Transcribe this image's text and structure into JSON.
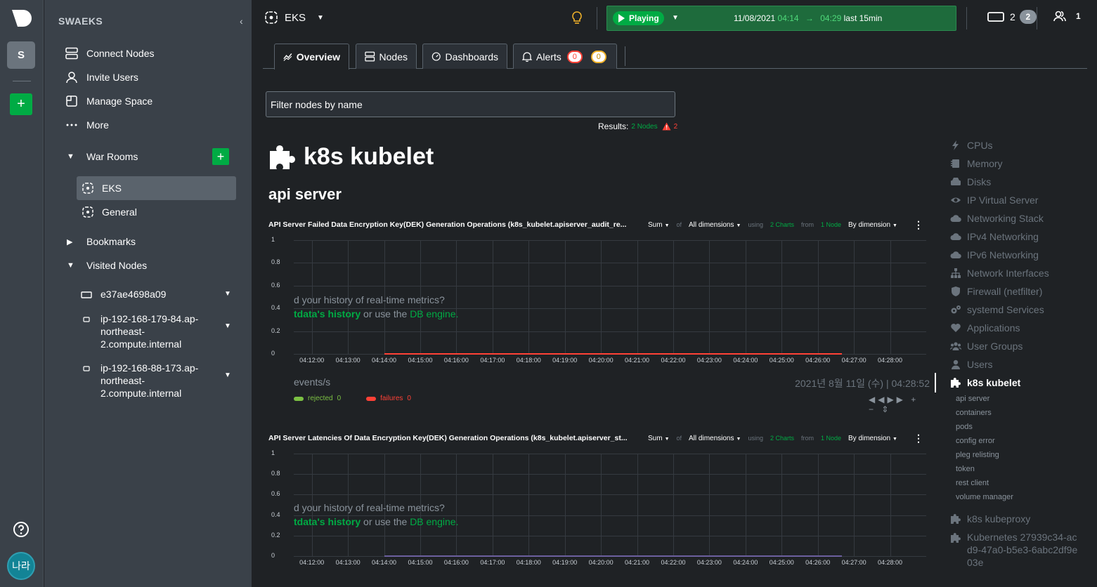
{
  "space": {
    "initial": "S",
    "name": "SWAEKS",
    "collapse": "‹"
  },
  "user": {
    "avatar_text": "나라"
  },
  "sidebar": {
    "items": [
      {
        "label": "Connect Nodes"
      },
      {
        "label": "Invite Users"
      },
      {
        "label": "Manage Space"
      },
      {
        "label": "More"
      }
    ],
    "war_rooms_label": "War Rooms",
    "rooms": [
      {
        "label": "EKS"
      },
      {
        "label": "General"
      }
    ],
    "bookmarks_label": "Bookmarks",
    "visited_label": "Visited Nodes",
    "visited_nodes": [
      {
        "label": "e37ae4698a09"
      },
      {
        "label": "ip-192-168-179-84.ap-northeast-2.compute.internal"
      },
      {
        "label": "ip-192-168-88-173.ap-northeast-2.compute.internal"
      }
    ]
  },
  "header": {
    "room": "EKS",
    "playing": "Playing",
    "date": "11/08/2021",
    "from": "04:14",
    "arrow": "→",
    "to": "04:29",
    "range": "last 15min",
    "nodes_count": "2",
    "nodes_badge": "2",
    "users_count": "1"
  },
  "tabs": [
    {
      "label": "Overview"
    },
    {
      "label": "Nodes"
    },
    {
      "label": "Dashboards"
    },
    {
      "label": "Alerts",
      "critical": "0",
      "warning": "0"
    }
  ],
  "filter": {
    "placeholder": "Filter nodes by name"
  },
  "results": {
    "label": "Results:",
    "nodes": "2 Nodes",
    "alerts": "2"
  },
  "section": {
    "title": "k8s kubelet",
    "subtitle": "api server"
  },
  "chart_data": [
    {
      "type": "line",
      "title": "API Server Failed Data Encryption Key(DEK) Generation Operations (k8s_kubelet.apiserver_audit_re...",
      "agg": "Sum",
      "of": "of",
      "dims": "All dimensions",
      "using": "using",
      "charts": "2 Charts",
      "from": "from",
      "nodes": "1 Node",
      "group": "By dimension",
      "y_ticks": [
        "1",
        "0.8",
        "0.6",
        "0.4",
        "0.2",
        "0"
      ],
      "x_ticks": [
        "04:12:00",
        "04:13:00",
        "04:14:00",
        "04:15:00",
        "04:16:00",
        "04:17:00",
        "04:18:00",
        "04:19:00",
        "04:20:00",
        "04:21:00",
        "04:22:00",
        "04:23:00",
        "04:24:00",
        "04:25:00",
        "04:26:00",
        "04:27:00",
        "04:28:00"
      ],
      "ylim": [
        0,
        1
      ],
      "overlay_1": "d your history of real-time metrics?",
      "overlay_2a": "tdata's ",
      "overlay_2b": "history",
      "overlay_2c": " or use the ",
      "overlay_2d": "DB engine",
      "overlay_2e": ".",
      "units": "events/s",
      "timestamp": "2021년 8월 11일 (수) | 04:28:52",
      "series": [
        {
          "name": "rejected",
          "value": "0",
          "color": "#7bc043"
        },
        {
          "name": "failures",
          "value": "0",
          "color": "#ff4136"
        }
      ],
      "line_color": "#ff4136",
      "line_start": "04:14:00",
      "line_end": "04:26:40"
    },
    {
      "type": "line",
      "title": "API Server Latencies Of Data Encryption Key(DEK) Generation Operations (k8s_kubelet.apiserver_st...",
      "agg": "Sum",
      "of": "of",
      "dims": "All dimensions",
      "using": "using",
      "charts": "2 Charts",
      "from": "from",
      "nodes": "1 Node",
      "group": "By dimension",
      "y_ticks": [
        "1",
        "0.8",
        "0.6",
        "0.4",
        "0.2",
        "0"
      ],
      "x_ticks": [
        "04:12:00",
        "04:13:00",
        "04:14:00",
        "04:15:00",
        "04:16:00",
        "04:17:00",
        "04:18:00",
        "04:19:00",
        "04:20:00",
        "04:21:00",
        "04:22:00",
        "04:23:00",
        "04:24:00",
        "04:25:00",
        "04:26:00",
        "04:27:00",
        "04:28:00"
      ],
      "ylim": [
        0,
        1
      ],
      "overlay_1": "d your history of real-time metrics?",
      "overlay_2a": "tdata's ",
      "overlay_2b": "history",
      "overlay_2c": " or use the ",
      "overlay_2d": "DB engine",
      "overlay_2e": ".",
      "line_color": "#6c5f9e",
      "line_start": "04:14:00",
      "line_end": "04:26:40"
    }
  ],
  "right_nav": [
    {
      "label": "CPUs",
      "icon": "bolt-icon"
    },
    {
      "label": "Memory",
      "icon": "memory-icon"
    },
    {
      "label": "Disks",
      "icon": "disk-icon"
    },
    {
      "label": "IP Virtual Server",
      "icon": "eye-icon"
    },
    {
      "label": "Networking Stack",
      "icon": "cloud-icon"
    },
    {
      "label": "IPv4 Networking",
      "icon": "cloud-icon"
    },
    {
      "label": "IPv6 Networking",
      "icon": "cloud-icon"
    },
    {
      "label": "Network Interfaces",
      "icon": "network-icon"
    },
    {
      "label": "Firewall (netfilter)",
      "icon": "shield-icon"
    },
    {
      "label": "systemd Services",
      "icon": "gears-icon"
    },
    {
      "label": "Applications",
      "icon": "heart-icon"
    },
    {
      "label": "User Groups",
      "icon": "users-icon"
    },
    {
      "label": "Users",
      "icon": "user-icon"
    },
    {
      "label": "k8s kubelet",
      "icon": "puzzle-icon",
      "active": true
    }
  ],
  "right_nav_sub": [
    "api server",
    "containers",
    "pods",
    "config error",
    "pleg relisting",
    "token",
    "rest client",
    "volume manager"
  ],
  "right_nav_after": [
    {
      "label": "k8s kubeproxy"
    },
    {
      "label": "Kubernetes 27939c34-acd9-47a0-b5e3-6abc2df9e03e"
    }
  ],
  "colors": {
    "accent": "#00ab44",
    "sidebar": "#3a4149",
    "background": "#1f2225"
  }
}
